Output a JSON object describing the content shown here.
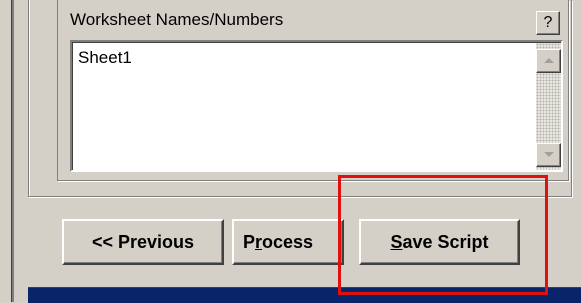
{
  "worksheet_group": {
    "label": "Worksheet Names/Numbers",
    "help_label": "?",
    "items": [
      "Sheet1"
    ]
  },
  "buttons": {
    "previous_label": "<< Previous",
    "process_prefix": "P",
    "process_mnemonic": "r",
    "process_suffix": "ocess",
    "save_mnemonic": "S",
    "save_suffix": "ave Script"
  },
  "icons": {
    "scroll_up": "triangle-up-icon",
    "scroll_down": "triangle-down-icon"
  },
  "colors": {
    "face": "#d4d0c8",
    "title_bar": "#0a246a",
    "highlight": "#e01010"
  }
}
